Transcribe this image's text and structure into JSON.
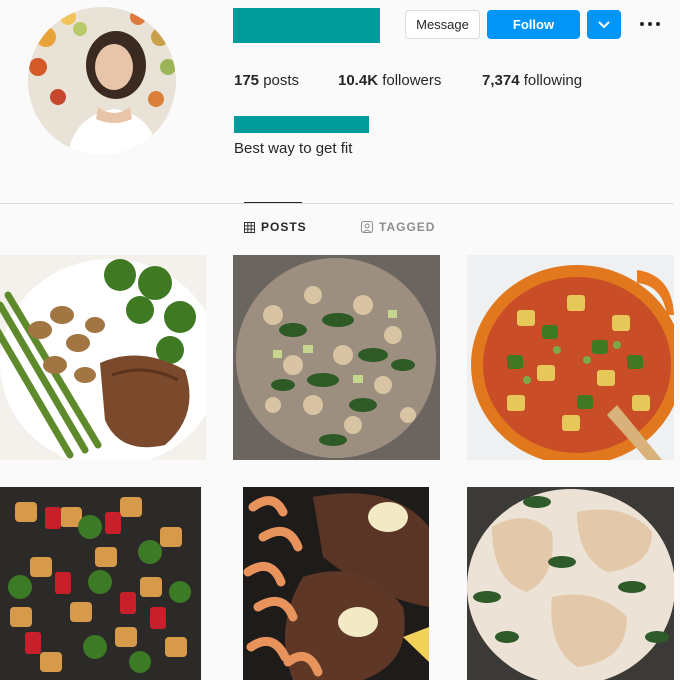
{
  "profile": {
    "username_redacted": true,
    "fullname_redacted": true,
    "bio": "Best way to get fit",
    "stats": {
      "posts_count": "175",
      "posts_label": "posts",
      "followers_count": "10.4K",
      "followers_label": "followers",
      "following_count": "7,374",
      "following_label": "following"
    }
  },
  "actions": {
    "message_label": "Message",
    "follow_label": "Follow"
  },
  "tabs": {
    "posts_label": "POSTS",
    "tagged_label": "TAGGED"
  },
  "colors": {
    "accent_blue": "#0095f6",
    "redaction_teal": "#009b9b",
    "divider": "#dbdbdb"
  },
  "icons": {
    "chevron": "chevron-down-icon",
    "more": "more-options-icon",
    "grid": "grid-icon",
    "tag": "tag-icon"
  },
  "grid_posts": [
    {
      "label": "steak with asparagus, mushrooms and broccoli"
    },
    {
      "label": "chicken with zucchini and spinach skillet"
    },
    {
      "label": "chicken vegetable stew in orange pot"
    },
    {
      "label": "chicken with peppers and broccoli"
    },
    {
      "label": "steak and shrimp with herb butter"
    },
    {
      "label": "creamy tuscan chicken with spinach"
    }
  ]
}
